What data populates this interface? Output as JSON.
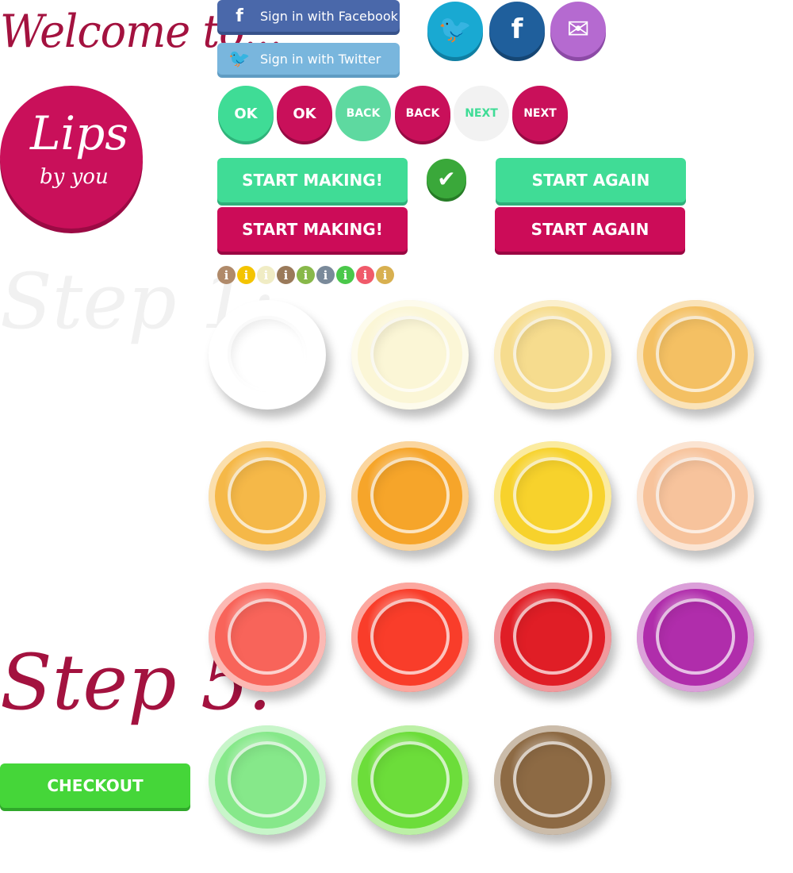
{
  "welcome": "Welcome to...",
  "logo": {
    "line1": "Lips",
    "line2": "by you"
  },
  "step1": "Step 1:",
  "step5": "Step 5:",
  "social": {
    "facebook_label": "Sign in with Facebook",
    "twitter_label": "Sign in with Twitter",
    "facebook_icon": "f",
    "twitter_icon": "🐦",
    "mail_icon": "✉"
  },
  "nav_buttons": [
    {
      "label": "OK",
      "style": "green"
    },
    {
      "label": "OK",
      "style": "pink"
    },
    {
      "label": "BACK",
      "style": "mint"
    },
    {
      "label": "BACK",
      "style": "pink"
    },
    {
      "label": "NEXT",
      "style": "light"
    },
    {
      "label": "NEXT",
      "style": "pink"
    }
  ],
  "actions": {
    "start_making_1": "START MAKING!",
    "start_making_2": "START MAKING!",
    "start_again_1": "START AGAIN",
    "start_again_2": "START AGAIN",
    "check_icon": "✔"
  },
  "info_dots": [
    {
      "label": "i",
      "color": "#b08a6a"
    },
    {
      "label": "i",
      "color": "#f4c400"
    },
    {
      "label": "i",
      "color": "#f0ecc4"
    },
    {
      "label": "i",
      "color": "#9a7a5a"
    },
    {
      "label": "i",
      "color": "#88b84a"
    },
    {
      "label": "i",
      "color": "#7a8a9a"
    },
    {
      "label": "i",
      "color": "#4ac84a"
    },
    {
      "label": "i",
      "color": "#f05a6a"
    },
    {
      "label": "i",
      "color": "#d8b050"
    }
  ],
  "colors": {
    "brand_pink": "#c9105a",
    "brand_green": "#40dc96",
    "checkout_green": "#45d639",
    "handwriting": "#a3123f"
  },
  "pots": [
    "#ffffff",
    "#fbf6d6",
    "#f6dc8e",
    "#f4c063",
    "#f5b848",
    "#f6a52a",
    "#f7d22c",
    "#f7c39c",
    "#f8645a",
    "#f93d2a",
    "#e01e26",
    "#b02dab",
    "#86e88a",
    "#6cdd3a",
    "#8d6a44"
  ],
  "checkout_label": "CHECKOUT"
}
